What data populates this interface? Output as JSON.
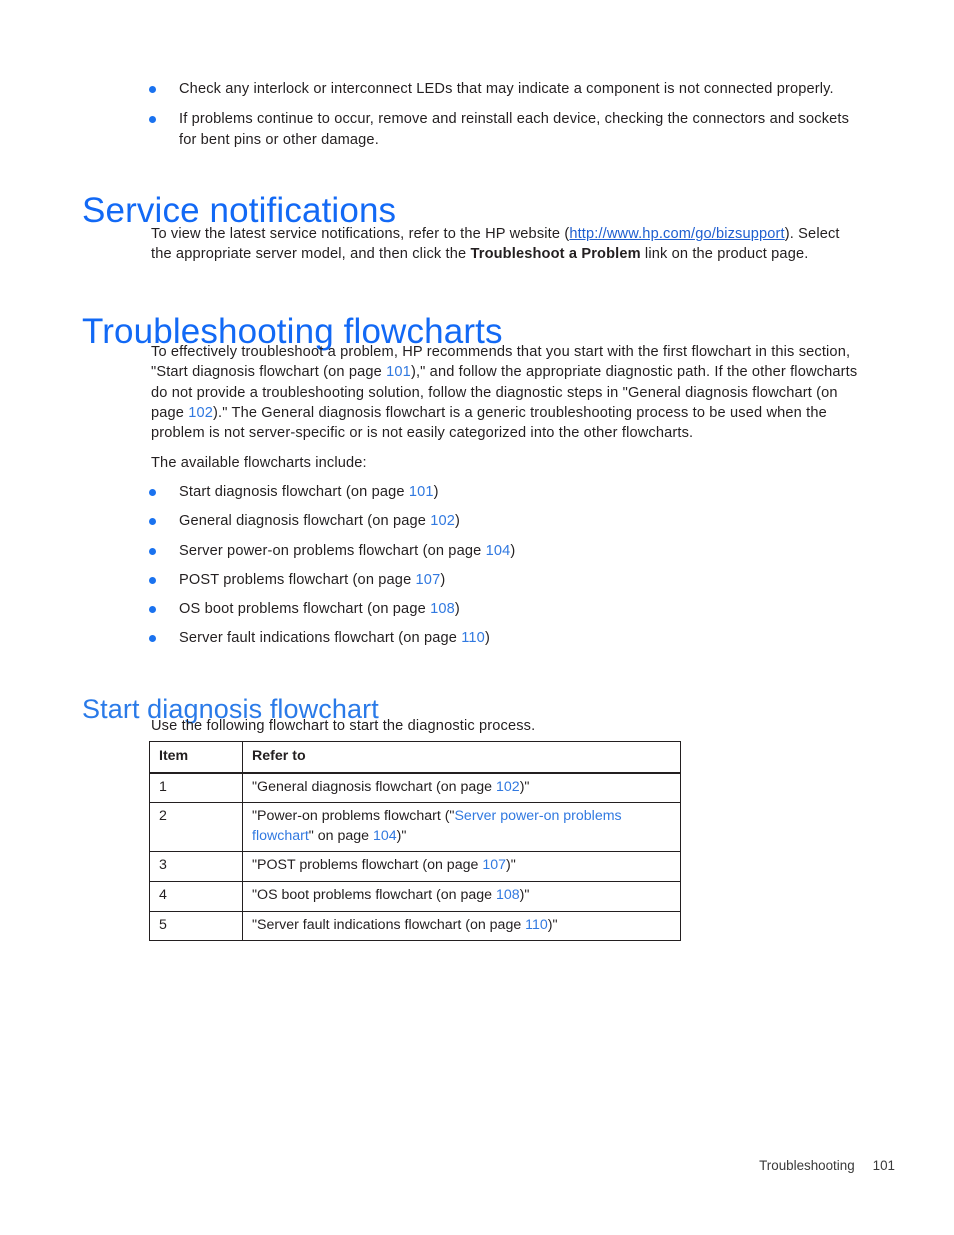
{
  "top_bullets": [
    "Check any interlock or interconnect LEDs that may indicate a component is not connected properly.",
    "If problems continue to occur, remove and reinstall each device, checking the connectors and sockets for bent pins or other damage."
  ],
  "service_notifications": {
    "heading": "Service notifications",
    "para_before_link": "To view the latest service notifications, refer to the HP website (",
    "link_text": "http://www.hp.com/go/bizsupport",
    "para_after_link": "). Select the appropriate server model, and then click the ",
    "bold_text": "Troubleshoot a Problem",
    "para_tail": " link on the product page."
  },
  "troubleshooting_flowcharts": {
    "heading": "Troubleshooting flowcharts",
    "intro_1": "To effectively troubleshoot a problem, HP recommends that you start with the first flowchart in this section, \"Start diagnosis flowchart (on page ",
    "intro_page_1": "101",
    "intro_2": "),\" and follow the appropriate diagnostic path. If the other flowcharts do not provide a troubleshooting solution, follow the diagnostic steps in \"General diagnosis flowchart (on page ",
    "intro_page_2": "102",
    "intro_3": ").\" The General diagnosis flowchart is a generic troubleshooting process to be used when the problem is not server-specific or is not easily categorized into the other flowcharts.",
    "available_lead": "The available flowcharts include:",
    "items": [
      {
        "label": "Start diagnosis flowchart (on page ",
        "page": "101",
        "tail": ")"
      },
      {
        "label": "General diagnosis flowchart (on page ",
        "page": "102",
        "tail": ")"
      },
      {
        "label": "Server power-on problems flowchart (on page ",
        "page": "104",
        "tail": ")"
      },
      {
        "label": "POST problems flowchart (on page ",
        "page": "107",
        "tail": ")"
      },
      {
        "label": "OS boot problems flowchart (on page ",
        "page": "108",
        "tail": ")"
      },
      {
        "label": "Server fault indications flowchart (on page ",
        "page": "110",
        "tail": ")"
      }
    ]
  },
  "start_diagnosis": {
    "heading": "Start diagnosis flowchart",
    "intro": "Use the following flowchart to start the diagnostic process.",
    "table": {
      "headers": [
        "Item",
        "Refer to"
      ],
      "rows": [
        {
          "item": "1",
          "pre": "\"General diagnosis flowchart (on page ",
          "page": "102",
          "post": ")\""
        },
        {
          "item": "2",
          "pre": "\"Power-on problems flowchart (\"",
          "link": "Server power-on problems flowchart",
          "mid": "\" on page ",
          "page": "104",
          "post": ")\""
        },
        {
          "item": "3",
          "pre": "\"POST problems flowchart (on page ",
          "page": "107",
          "post": ")\""
        },
        {
          "item": "4",
          "pre": "\"OS boot problems flowchart (on page ",
          "page": "108",
          "post": ")\""
        },
        {
          "item": "5",
          "pre": "\"Server fault indications flowchart (on page ",
          "page": "110",
          "post": ")\""
        }
      ]
    }
  },
  "footer": {
    "section": "Troubleshooting",
    "page_number": "101"
  },
  "colors": {
    "heading_blue": "#1269f5",
    "subheading_blue": "#2a7ae8",
    "xref_blue": "#3179e0",
    "bullet_blue": "#1a72ef",
    "url_blue": "#1f5fd0",
    "body_text": "#231f20"
  }
}
